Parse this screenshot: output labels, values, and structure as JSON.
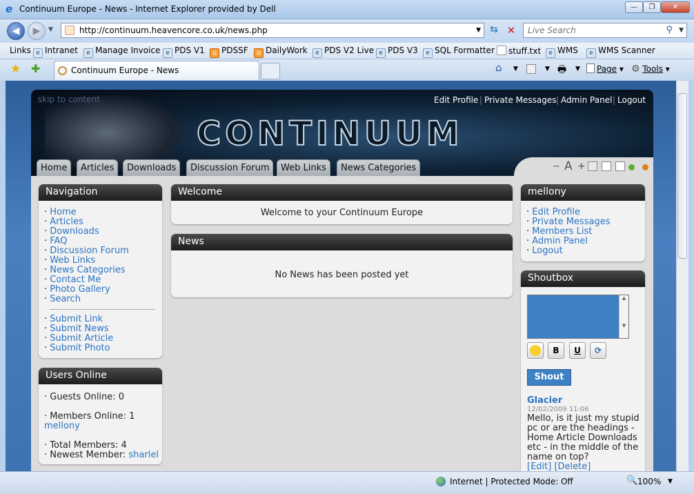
{
  "window": {
    "title": "Continuum Europe - News - Internet Explorer provided by Dell"
  },
  "browser": {
    "address": "http://continuum.heavencore.co.uk/news.php",
    "search_placeholder": "Live Search",
    "links_label": "Links",
    "links": [
      "Intranet",
      "Manage Invoice",
      "PDS V1",
      "PDSSF",
      "DailyWork",
      "PDS V2 Live",
      "PDS V3",
      "SQL Formatter",
      "stuff.txt",
      "WMS",
      "WMS Scanner"
    ],
    "tab_title": "Continuum Europe - News",
    "page_menu": "Page",
    "tools_menu": "Tools",
    "status_zone": "Internet | Protected Mode: Off",
    "zoom": "100%"
  },
  "site": {
    "skip_link": "skip to content",
    "logo": "CONTINUUM",
    "top_links": [
      "Edit Profile",
      "Private Messages",
      "Admin Panel",
      "Logout"
    ],
    "tabs": [
      "Home",
      "Articles",
      "Downloads",
      "Discussion Forum",
      "Web Links",
      "News Categories"
    ],
    "font_controls": [
      "−",
      "A",
      "+"
    ]
  },
  "navigation": {
    "title": "Navigation",
    "items": [
      "Home",
      "Articles",
      "Downloads",
      "FAQ",
      "Discussion Forum",
      "Web Links",
      "News Categories",
      "Contact Me",
      "Photo Gallery",
      "Search"
    ],
    "submit_items": [
      "Submit Link",
      "Submit News",
      "Submit Article",
      "Submit Photo"
    ]
  },
  "users_online": {
    "title": "Users Online",
    "guests": "· Guests Online: 0",
    "members": "· Members Online: 1",
    "member_name": "mellony",
    "total": "· Total Members: 4",
    "newest_label": "· Newest Member:",
    "newest_name": "sharlel"
  },
  "welcome": {
    "title": "Welcome",
    "text": "Welcome to your Continuum Europe"
  },
  "news": {
    "title": "News",
    "text": "No News has been posted yet"
  },
  "user_panel": {
    "title": "mellony",
    "items": [
      "Edit Profile",
      "Private Messages",
      "Members List",
      "Admin Panel",
      "Logout"
    ]
  },
  "shoutbox": {
    "title": "Shoutbox",
    "button": "Shout",
    "tools": [
      "B",
      "U"
    ],
    "post": {
      "author": "Glacier",
      "date": "12/02/2009 11:06",
      "text": "Mello, is it just my stupid pc or are the headings - Home Article Downloads etc - in the middle of the name on top?",
      "edit": "[Edit]",
      "delete": "[Delete]"
    }
  }
}
